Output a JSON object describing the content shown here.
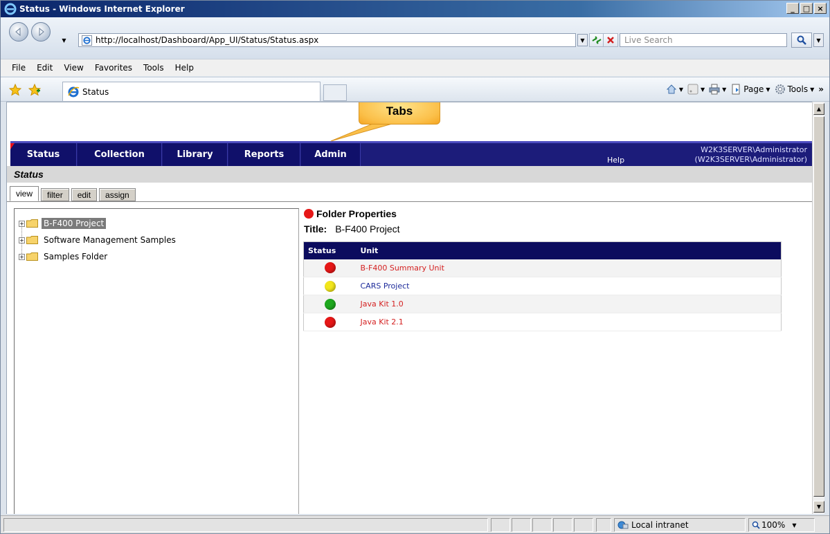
{
  "window": {
    "title": "Status - Windows Internet Explorer",
    "minimize": "_",
    "maximize": "□",
    "close": "×"
  },
  "address": {
    "url": "http://localhost/Dashboard/App_UI/Status/Status.aspx",
    "search_placeholder": "Live Search"
  },
  "menu": [
    "File",
    "Edit",
    "View",
    "Favorites",
    "Tools",
    "Help"
  ],
  "browser_tab": {
    "label": "Status"
  },
  "command_bar": {
    "page": "Page",
    "tools": "Tools"
  },
  "callout": {
    "text": "Tabs"
  },
  "app": {
    "nav_tabs": [
      "Status",
      "Collection",
      "Library",
      "Reports",
      "Admin"
    ],
    "help": "Help",
    "user_line1": "W2K3SERVER\\Administrator",
    "user_line2": "(W2K3SERVER\\Administrator)",
    "page_title": "Status",
    "view_tabs": [
      "view",
      "filter",
      "edit",
      "assign"
    ]
  },
  "tree": {
    "items": [
      "B-F400 Project",
      "Software Management Samples",
      "Samples Folder"
    ]
  },
  "properties": {
    "heading": "Folder Properties",
    "title_key": "Title:",
    "title_value": "B-F400 Project",
    "columns": [
      "Status",
      "Unit"
    ],
    "rows": [
      {
        "unit": "B-F400 Summary Unit",
        "status_color": "#e61717",
        "link_color": "#d42020"
      },
      {
        "unit": "CARS Project",
        "status_color": "#f2e61c",
        "link_color": "#1c2a9a"
      },
      {
        "unit": "Java Kit 1.0",
        "status_color": "#1ea81e",
        "link_color": "#d42020"
      },
      {
        "unit": "Java Kit 2.1",
        "status_color": "#e61717",
        "link_color": "#d42020"
      }
    ]
  },
  "statusbar": {
    "zone": "Local intranet",
    "zoom": "100%"
  }
}
